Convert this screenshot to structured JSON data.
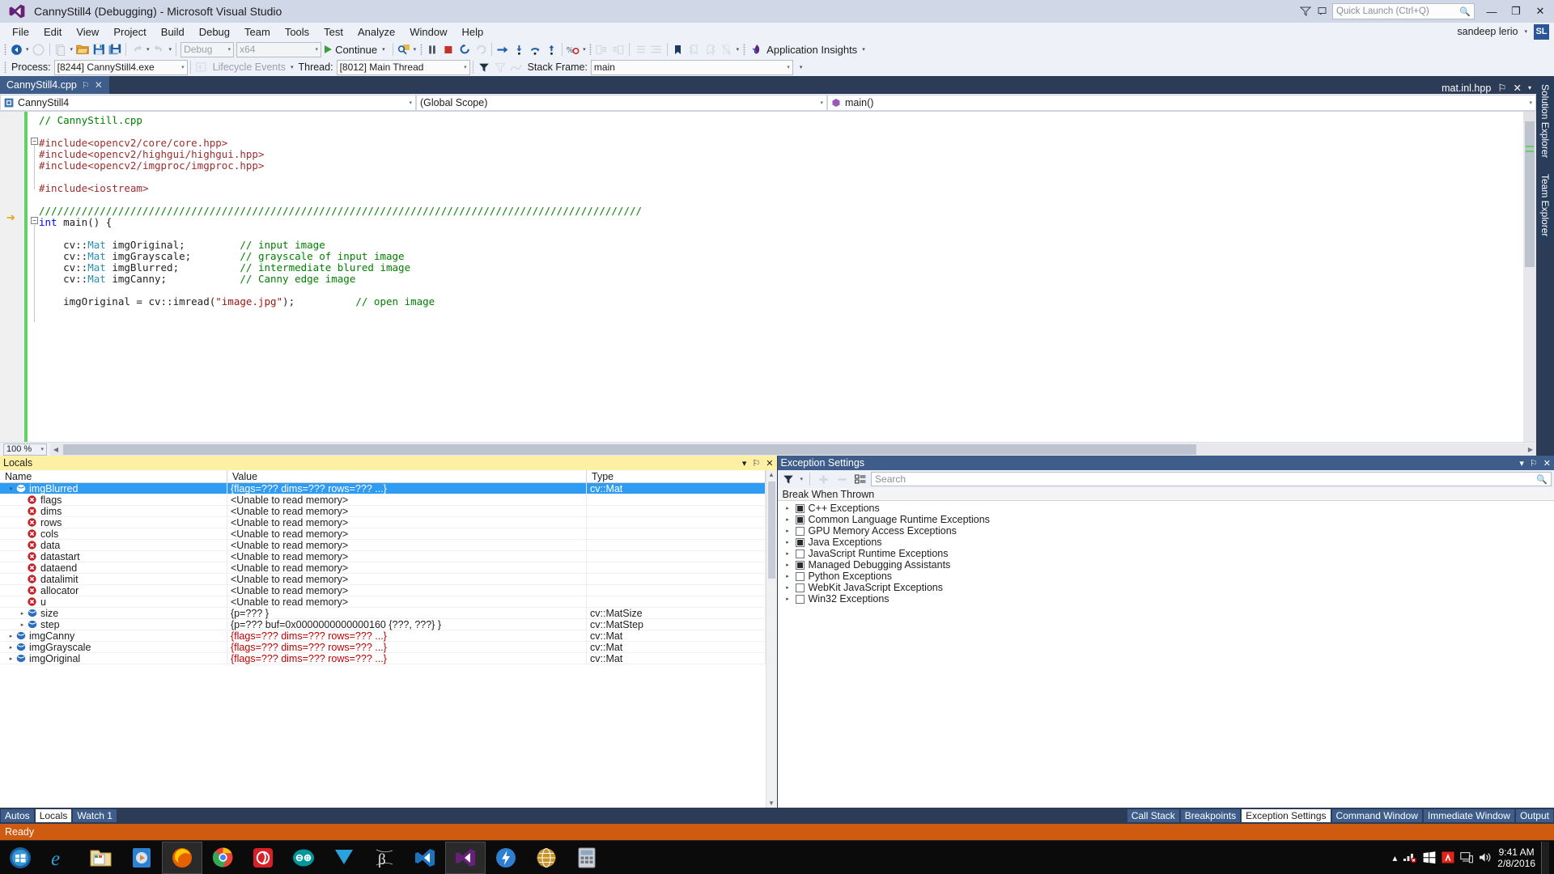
{
  "window": {
    "title": "CannyStill4 (Debugging) - Microsoft Visual Studio",
    "minimize_label": "—",
    "maximize_label": "❐",
    "close_label": "✕"
  },
  "quick_launch": {
    "placeholder": "Quick Launch (Ctrl+Q)",
    "icon": "search-icon"
  },
  "account": {
    "user": "sandeep lerio",
    "initials": "SL",
    "caret": "▾"
  },
  "menu": {
    "items": [
      "File",
      "Edit",
      "View",
      "Project",
      "Build",
      "Debug",
      "Team",
      "Tools",
      "Test",
      "Analyze",
      "Window",
      "Help"
    ]
  },
  "toolbar": {
    "config": "Debug",
    "platform": "x64",
    "continue_label": "Continue",
    "app_insights_label": "Application Insights",
    "dropdown_caret": "▾"
  },
  "debug_location": {
    "process_label": "Process:",
    "process_value": "[8244] CannyStill4.exe",
    "lifecycle_label": "Lifecycle Events",
    "thread_label": "Thread:",
    "thread_value": "[8012] Main Thread",
    "stackframe_label": "Stack Frame:",
    "stackframe_value": "main"
  },
  "document_tabs": {
    "active": "CannyStill4.cpp",
    "pin_glyph": "⚐",
    "close_glyph": "✕",
    "right_tab": "mat.inl.hpp",
    "right_close": "✕",
    "right_caret": "▾"
  },
  "navbar": {
    "project": "CannyStill4",
    "scope": "(Global Scope)",
    "member": "main()"
  },
  "editor": {
    "zoom": "100 %",
    "lines": [
      {
        "indent": 0,
        "tokens": [
          {
            "t": "com",
            "v": "// CannyStill.cpp"
          }
        ]
      },
      {
        "indent": 0,
        "tokens": []
      },
      {
        "indent": 0,
        "tokens": [
          {
            "t": "pp",
            "v": "#include"
          },
          {
            "t": "pp",
            "v": "<opencv2/core/core.hpp>"
          }
        ]
      },
      {
        "indent": 0,
        "tokens": [
          {
            "t": "pp",
            "v": "#include"
          },
          {
            "t": "pp",
            "v": "<opencv2/highgui/highgui.hpp>"
          }
        ]
      },
      {
        "indent": 0,
        "tokens": [
          {
            "t": "pp",
            "v": "#include"
          },
          {
            "t": "pp",
            "v": "<opencv2/imgproc/imgproc.hpp>"
          }
        ]
      },
      {
        "indent": 0,
        "tokens": []
      },
      {
        "indent": 0,
        "tokens": [
          {
            "t": "pp",
            "v": "#include"
          },
          {
            "t": "pp",
            "v": "<iostream>"
          }
        ]
      },
      {
        "indent": 0,
        "tokens": []
      },
      {
        "indent": 0,
        "tokens": [
          {
            "t": "com",
            "v": "///////////////////////////////////////////////////////////////////////////////////////////////////"
          }
        ]
      },
      {
        "indent": 0,
        "tokens": [
          {
            "t": "kw",
            "v": "int"
          },
          {
            "t": "pl",
            "v": " main() {"
          }
        ]
      },
      {
        "indent": 0,
        "tokens": []
      },
      {
        "indent": 0,
        "tokens": [
          {
            "t": "pl",
            "v": "    cv::"
          },
          {
            "t": "ty",
            "v": "Mat"
          },
          {
            "t": "pl",
            "v": " imgOriginal;         "
          },
          {
            "t": "com",
            "v": "// input image"
          }
        ]
      },
      {
        "indent": 0,
        "tokens": [
          {
            "t": "pl",
            "v": "    cv::"
          },
          {
            "t": "ty",
            "v": "Mat"
          },
          {
            "t": "pl",
            "v": " imgGrayscale;        "
          },
          {
            "t": "com",
            "v": "// grayscale of input image"
          }
        ]
      },
      {
        "indent": 0,
        "tokens": [
          {
            "t": "pl",
            "v": "    cv::"
          },
          {
            "t": "ty",
            "v": "Mat"
          },
          {
            "t": "pl",
            "v": " imgBlurred;          "
          },
          {
            "t": "com",
            "v": "// intermediate blured image"
          }
        ]
      },
      {
        "indent": 0,
        "tokens": [
          {
            "t": "pl",
            "v": "    cv::"
          },
          {
            "t": "ty",
            "v": "Mat"
          },
          {
            "t": "pl",
            "v": " imgCanny;            "
          },
          {
            "t": "com",
            "v": "// Canny edge image"
          }
        ]
      },
      {
        "indent": 0,
        "tokens": []
      },
      {
        "indent": 0,
        "tokens": [
          {
            "t": "pl",
            "v": "    imgOriginal = cv::imread("
          },
          {
            "t": "str",
            "v": "\"image.jpg\""
          },
          {
            "t": "pl",
            "v": ");          "
          },
          {
            "t": "com",
            "v": "// open image"
          }
        ]
      }
    ]
  },
  "right_dock": {
    "tabs": [
      "Solution Explorer",
      "Team Explorer"
    ]
  },
  "locals": {
    "title": "Locals",
    "title_actions": {
      "caret": "▾",
      "pin": "⚐",
      "close": "✕"
    },
    "columns": [
      "Name",
      "Value",
      "Type"
    ],
    "rows": [
      {
        "name": "imgBlurred",
        "value": "{flags=??? dims=??? rows=??? ...}",
        "type": "cv::Mat",
        "indent": 0,
        "expander": "▾",
        "icon": "object-icon",
        "selected": true,
        "value_red": false
      },
      {
        "name": "flags",
        "value": "<Unable to read memory>",
        "type": "",
        "indent": 1,
        "expander": "",
        "icon": "error-icon",
        "selected": false,
        "value_red": false
      },
      {
        "name": "dims",
        "value": "<Unable to read memory>",
        "type": "",
        "indent": 1,
        "expander": "",
        "icon": "error-icon",
        "selected": false,
        "value_red": false
      },
      {
        "name": "rows",
        "value": "<Unable to read memory>",
        "type": "",
        "indent": 1,
        "expander": "",
        "icon": "error-icon",
        "selected": false,
        "value_red": false
      },
      {
        "name": "cols",
        "value": "<Unable to read memory>",
        "type": "",
        "indent": 1,
        "expander": "",
        "icon": "error-icon",
        "selected": false,
        "value_red": false
      },
      {
        "name": "data",
        "value": "<Unable to read memory>",
        "type": "",
        "indent": 1,
        "expander": "",
        "icon": "error-icon",
        "selected": false,
        "value_red": false
      },
      {
        "name": "datastart",
        "value": "<Unable to read memory>",
        "type": "",
        "indent": 1,
        "expander": "",
        "icon": "error-icon",
        "selected": false,
        "value_red": false
      },
      {
        "name": "dataend",
        "value": "<Unable to read memory>",
        "type": "",
        "indent": 1,
        "expander": "",
        "icon": "error-icon",
        "selected": false,
        "value_red": false
      },
      {
        "name": "datalimit",
        "value": "<Unable to read memory>",
        "type": "",
        "indent": 1,
        "expander": "",
        "icon": "error-icon",
        "selected": false,
        "value_red": false
      },
      {
        "name": "allocator",
        "value": "<Unable to read memory>",
        "type": "",
        "indent": 1,
        "expander": "",
        "icon": "error-icon",
        "selected": false,
        "value_red": false
      },
      {
        "name": "u",
        "value": "<Unable to read memory>",
        "type": "",
        "indent": 1,
        "expander": "",
        "icon": "error-icon",
        "selected": false,
        "value_red": false
      },
      {
        "name": "size",
        "value": "{p=??? }",
        "type": "cv::MatSize",
        "indent": 1,
        "expander": "▸",
        "icon": "object-icon",
        "selected": false,
        "value_red": false
      },
      {
        "name": "step",
        "value": "{p=??? buf=0x0000000000000160 {???, ???} }",
        "type": "cv::MatStep",
        "indent": 1,
        "expander": "▸",
        "icon": "object-icon",
        "selected": false,
        "value_red": false
      },
      {
        "name": "imgCanny",
        "value": "{flags=??? dims=??? rows=??? ...}",
        "type": "cv::Mat",
        "indent": 0,
        "expander": "▸",
        "icon": "object-icon",
        "selected": false,
        "value_red": true
      },
      {
        "name": "imgGrayscale",
        "value": "{flags=??? dims=??? rows=??? ...}",
        "type": "cv::Mat",
        "indent": 0,
        "expander": "▸",
        "icon": "object-icon",
        "selected": false,
        "value_red": true
      },
      {
        "name": "imgOriginal",
        "value": "{flags=??? dims=??? rows=??? ...}",
        "type": "cv::Mat",
        "indent": 0,
        "expander": "▸",
        "icon": "object-icon",
        "selected": false,
        "value_red": true
      }
    ]
  },
  "exception_settings": {
    "title": "Exception Settings",
    "title_actions": {
      "caret": "▾",
      "pin": "⚐",
      "close": "✕"
    },
    "search_placeholder": "Search",
    "column_header": "Break When Thrown",
    "filter_caret": "▾",
    "rows": [
      {
        "label": "C++ Exceptions",
        "expander": "▸",
        "checked": "partial"
      },
      {
        "label": "Common Language Runtime Exceptions",
        "expander": "▸",
        "checked": "partial"
      },
      {
        "label": "GPU Memory Access Exceptions",
        "expander": "▸",
        "checked": "unchecked"
      },
      {
        "label": "Java Exceptions",
        "expander": "▸",
        "checked": "partial"
      },
      {
        "label": "JavaScript Runtime Exceptions",
        "expander": "▸",
        "checked": "unchecked"
      },
      {
        "label": "Managed Debugging Assistants",
        "expander": "▸",
        "checked": "partial"
      },
      {
        "label": "Python Exceptions",
        "expander": "▸",
        "checked": "unchecked"
      },
      {
        "label": "WebKit JavaScript Exceptions",
        "expander": "▸",
        "checked": "unchecked"
      },
      {
        "label": "Win32 Exceptions",
        "expander": "▸",
        "checked": "unchecked"
      }
    ]
  },
  "bottom_tabs_left": {
    "tabs": [
      "Autos",
      "Locals",
      "Watch 1"
    ],
    "active": "Locals"
  },
  "bottom_tabs_right": {
    "tabs": [
      "Call Stack",
      "Breakpoints",
      "Exception Settings",
      "Command Window",
      "Immediate Window",
      "Output"
    ],
    "active": "Exception Settings"
  },
  "statusbar": {
    "text": "Ready",
    "color": "#cf5b10"
  },
  "taskbar": {
    "items": [
      "start-orb-icon",
      "internet-explorer-icon",
      "file-explorer-icon",
      "windows-media-player-icon",
      "firefox-icon",
      "chrome-icon",
      "adobe-creative-cloud-icon",
      "arduino-icon",
      "utorrent-icon",
      "processing-icon",
      "visual-studio-icon",
      "visual-studio-2015-icon",
      "cheat-engine-icon",
      "internet-icon",
      "calculator-icon"
    ],
    "active_index": 11,
    "tray": {
      "expand": "▴",
      "network_icon": "network-error-icon",
      "windows-icon": "windows-store-icon",
      "antivirus_icon": "avira-icon",
      "display_icon": "display-icon",
      "volume_icon": "volume-icon"
    },
    "clock_time": "9:41 AM",
    "clock_date": "2/8/2016"
  },
  "colors": {
    "accent_blue": "#2f9cf4",
    "title_bar": "#d0d8e8",
    "dock_blue": "#2d3c56",
    "panel_active_yellow": "#fdf0a5",
    "status_orange": "#cf5b10",
    "error_red": "#c00000",
    "comment_green": "#008000"
  }
}
